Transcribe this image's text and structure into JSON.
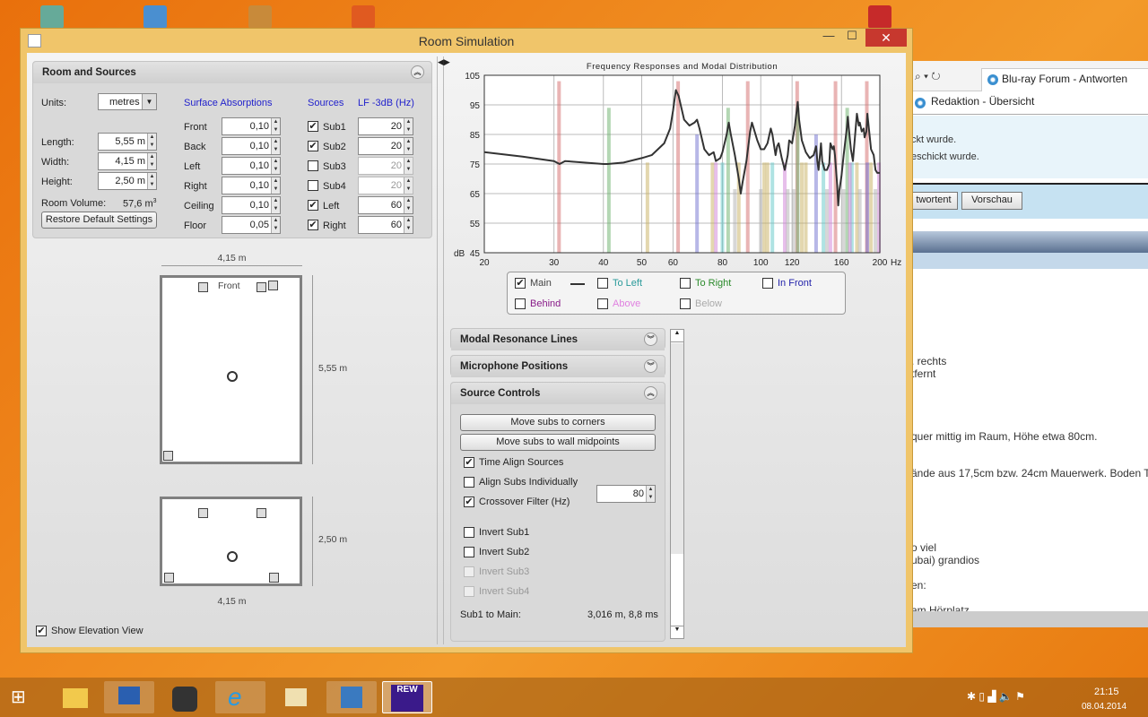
{
  "window": {
    "title": "Room Simulation",
    "minimize": "—",
    "maximize": "☐",
    "close": "✕"
  },
  "room_sources": {
    "title": "Room and Sources",
    "units_label": "Units:",
    "units_value": "metres",
    "length_label": "Length:",
    "length": "5,55 m",
    "width_label": "Width:",
    "width": "4,15 m",
    "height_label": "Height:",
    "height": "2,50 m",
    "volume_label": "Room Volume:",
    "volume": "57,6 m",
    "volume_unit_sup": "3",
    "restore_button": "Restore Default Settings",
    "absorption_header": "Surface Absorptions",
    "absorptions": [
      {
        "label": "Front",
        "value": "0,10"
      },
      {
        "label": "Back",
        "value": "0,10"
      },
      {
        "label": "Left",
        "value": "0,10"
      },
      {
        "label": "Right",
        "value": "0,10"
      },
      {
        "label": "Ceiling",
        "value": "0,10"
      },
      {
        "label": "Floor",
        "value": "0,05"
      }
    ],
    "sources_header": "Sources",
    "lf_header": "LF -3dB (Hz)",
    "sources": [
      {
        "label": "Sub1",
        "checked": true,
        "lf": "20"
      },
      {
        "label": "Sub2",
        "checked": true,
        "lf": "20"
      },
      {
        "label": "Sub3",
        "checked": false,
        "lf": "20"
      },
      {
        "label": "Sub4",
        "checked": false,
        "lf": "20"
      },
      {
        "label": "Left",
        "checked": true,
        "lf": "60"
      },
      {
        "label": "Right",
        "checked": true,
        "lf": "60"
      }
    ]
  },
  "plan": {
    "width_dim": "4,15 m",
    "length_dim": "5,55 m",
    "front_label": "Front",
    "height_dim": "2,50 m",
    "width_dim2": "4,15 m",
    "show_elevation": "Show Elevation View",
    "show_elevation_checked": true
  },
  "chart_data": {
    "type": "line",
    "title": "Frequency Responses and Modal Distribution",
    "ylabel": "dB",
    "xlabel": "Hz",
    "xscale": "log",
    "xlim": [
      20,
      200
    ],
    "ylim": [
      45,
      105
    ],
    "xticks": [
      20,
      30,
      40,
      50,
      60,
      80,
      100,
      120,
      160,
      200
    ],
    "yticks": [
      45,
      55,
      65,
      75,
      85,
      95,
      105
    ],
    "grid": true,
    "series": [
      {
        "name": "Main",
        "color": "#333333",
        "x": [
          20,
          25,
          30,
          31,
          32,
          40,
          41,
          45,
          50,
          53,
          57,
          59,
          60,
          61,
          62,
          64,
          66,
          68,
          69,
          70,
          72,
          74,
          76,
          77,
          79,
          80,
          82,
          83,
          84,
          86,
          88,
          89,
          90,
          92,
          94,
          95,
          96,
          98,
          100,
          102,
          104,
          106,
          107,
          109,
          110,
          111,
          113,
          115,
          117,
          118,
          120,
          122,
          124,
          125,
          127,
          130,
          133,
          136,
          138,
          139,
          140,
          142,
          143,
          145,
          147,
          149,
          150,
          152,
          153,
          154,
          156,
          157,
          158,
          160,
          162,
          165,
          166,
          167,
          169,
          171,
          173,
          175,
          177,
          178,
          180,
          182,
          183,
          185,
          186,
          188,
          190,
          193,
          195,
          197,
          200
        ],
        "y": [
          79,
          77.5,
          76,
          75,
          76,
          75,
          75,
          75.5,
          77,
          78,
          82,
          87,
          93,
          100,
          98,
          90,
          88,
          89,
          90,
          87,
          80,
          78,
          79,
          76,
          77,
          79,
          85,
          89,
          85,
          78,
          70,
          65,
          69,
          76,
          86,
          89,
          87,
          83,
          80,
          80,
          82,
          87,
          85,
          78,
          81,
          82,
          77,
          73,
          78,
          83,
          82,
          88,
          96,
          90,
          83,
          79,
          77,
          78,
          81,
          76,
          73,
          82,
          76,
          73,
          73,
          75,
          82,
          80,
          81,
          78,
          68,
          61,
          66,
          71,
          78,
          87,
          91,
          87,
          80,
          76,
          84,
          92,
          88,
          89,
          86,
          87,
          84,
          86,
          92,
          86,
          80,
          78,
          73,
          72,
          72
        ]
      }
    ],
    "modes": [
      {
        "f": 30.9,
        "db": 103,
        "color": "#d46a6a"
      },
      {
        "f": 61.8,
        "db": 103,
        "color": "#d46a6a"
      },
      {
        "f": 92.7,
        "db": 103,
        "color": "#d46a6a"
      },
      {
        "f": 123.6,
        "db": 103,
        "color": "#d46a6a"
      },
      {
        "f": 154.5,
        "db": 103,
        "color": "#d46a6a"
      },
      {
        "f": 185.4,
        "db": 103,
        "color": "#d46a6a"
      },
      {
        "f": 41.3,
        "db": 94,
        "color": "#6aaf6a"
      },
      {
        "f": 82.7,
        "db": 94,
        "color": "#6aaf6a"
      },
      {
        "f": 124,
        "db": 94,
        "color": "#6aaf6a"
      },
      {
        "f": 165.4,
        "db": 94,
        "color": "#6aaf6a"
      },
      {
        "f": 51.7,
        "db": 75.5,
        "color": "#c8b060"
      },
      {
        "f": 75.5,
        "db": 75.5,
        "color": "#c8b060"
      },
      {
        "f": 88,
        "db": 75.5,
        "color": "#c8b060"
      },
      {
        "f": 102,
        "db": 75.5,
        "color": "#c8b060"
      },
      {
        "f": 104,
        "db": 75.5,
        "color": "#c8b060"
      },
      {
        "f": 127,
        "db": 75.5,
        "color": "#c8b060"
      },
      {
        "f": 130,
        "db": 75.5,
        "color": "#c8b060"
      },
      {
        "f": 175,
        "db": 75.5,
        "color": "#c8b060"
      },
      {
        "f": 190,
        "db": 75.5,
        "color": "#c8b060"
      },
      {
        "f": 69,
        "db": 85,
        "color": "#7070d0"
      },
      {
        "f": 138,
        "db": 85,
        "color": "#7070d0"
      },
      {
        "f": 186,
        "db": 75.5,
        "color": "#7070d0"
      },
      {
        "f": 80,
        "db": 75.5,
        "color": "#60c8c8"
      },
      {
        "f": 107,
        "db": 75.5,
        "color": "#60c8c8"
      },
      {
        "f": 144,
        "db": 75.5,
        "color": "#60c8c8"
      },
      {
        "f": 170,
        "db": 75.5,
        "color": "#60c8c8"
      },
      {
        "f": 77,
        "db": 75.5,
        "color": "#d080d8"
      },
      {
        "f": 115,
        "db": 75.5,
        "color": "#d080d8"
      },
      {
        "f": 150,
        "db": 75.5,
        "color": "#d080d8"
      },
      {
        "f": 168,
        "db": 75.5,
        "color": "#d080d8"
      },
      {
        "f": 199,
        "db": 75.5,
        "color": "#d080d8"
      },
      {
        "f": 86,
        "db": 66.5,
        "color": "#b0b0b0"
      },
      {
        "f": 100,
        "db": 66.5,
        "color": "#b0b0b0"
      },
      {
        "f": 117,
        "db": 66.5,
        "color": "#b0b0b0"
      },
      {
        "f": 121,
        "db": 66.5,
        "color": "#b0b0b0"
      },
      {
        "f": 147,
        "db": 66.5,
        "color": "#b0b0b0"
      },
      {
        "f": 162,
        "db": 66.5,
        "color": "#b0b0b0"
      },
      {
        "f": 178,
        "db": 66.5,
        "color": "#b0b0b0"
      },
      {
        "f": 195,
        "db": 66.5,
        "color": "#b0b0b0"
      }
    ],
    "legend": [
      {
        "label": "Main",
        "checked": true,
        "color": "#444444"
      },
      {
        "label": "To Left",
        "checked": false,
        "color": "#2a9a9a"
      },
      {
        "label": "To Right",
        "checked": false,
        "color": "#2a8a2a"
      },
      {
        "label": "In Front",
        "checked": false,
        "color": "#2222aa"
      },
      {
        "label": "Behind",
        "checked": false,
        "color": "#881a88"
      },
      {
        "label": "Above",
        "checked": false,
        "color": "#e080e0"
      },
      {
        "label": "Below",
        "checked": false,
        "color": "#aaaaaa"
      }
    ]
  },
  "accordion": {
    "modal": "Modal Resonance Lines",
    "mic": "Microphone Positions",
    "source": "Source Controls"
  },
  "source_controls": {
    "corners_button": "Move subs to corners",
    "midpoints_button": "Move subs to wall midpoints",
    "options": [
      {
        "label": "Time Align Sources",
        "checked": true
      },
      {
        "label": "Align Subs Individually",
        "checked": false
      },
      {
        "label": "Crossover Filter (Hz)",
        "checked": true
      }
    ],
    "crossover_value": "80",
    "inverts": [
      {
        "label": "Invert Sub1",
        "checked": false,
        "enabled": true
      },
      {
        "label": "Invert Sub2",
        "checked": false,
        "enabled": true
      },
      {
        "label": "Invert Sub3",
        "checked": false,
        "enabled": false
      },
      {
        "label": "Invert Sub4",
        "checked": false,
        "enabled": false
      }
    ],
    "sub1_label": "Sub1 to Main:",
    "sub1_value": "3,016 m, 8,8 ms"
  },
  "browser": {
    "tab": "Blu-ray Forum - Antworten",
    "favorite": "Redaktion - Übersicht",
    "lines": [
      "ckt wurde.",
      "eschickt wurde."
    ],
    "buttons": [
      "twortent",
      "Vorschau"
    ],
    "body": [
      ". rechts",
      "tfernt",
      "quer mittig im Raum, Höhe etwa 80cm.",
      "ände aus 17,5cm bzw. 24cm Mauerwerk. Boden T",
      "o viel",
      "ubai) grandios",
      "en:",
      "am Hörplatz"
    ]
  },
  "taskbar": {
    "items": [
      "start",
      "file-explorer",
      "remote-desktop",
      "steam",
      "internet-explorer",
      "mail",
      "control-panel",
      "rew"
    ],
    "rew_label": "REW",
    "time": "21:15",
    "date": "08.04.2014"
  }
}
